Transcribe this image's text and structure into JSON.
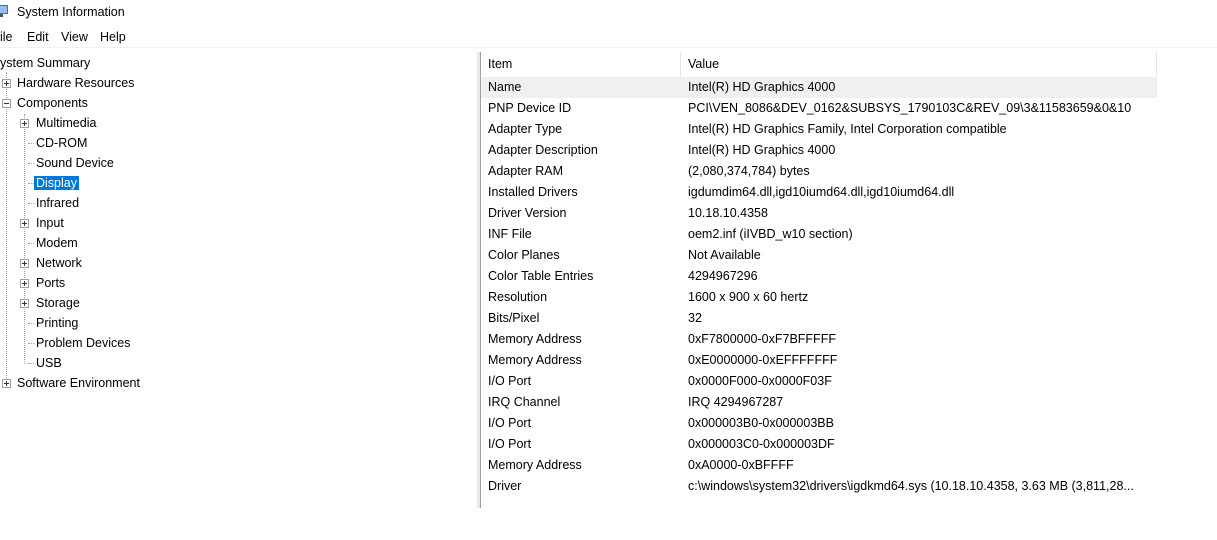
{
  "window": {
    "title": "System Information"
  },
  "menu": [
    "ile",
    "Edit",
    "View",
    "Help"
  ],
  "tree": {
    "root": "ystem Summary",
    "hardware_resources": "Hardware Resources",
    "components": "Components",
    "children": [
      "Multimedia",
      "CD-ROM",
      "Sound Device",
      "Display",
      "Infrared",
      "Input",
      "Modem",
      "Network",
      "Ports",
      "Storage",
      "Printing",
      "Problem Devices",
      "USB"
    ],
    "software_environment": "Software Environment",
    "selected": "Display"
  },
  "table": {
    "columns": [
      "Item",
      "Value"
    ],
    "rows": [
      [
        "Name",
        "Intel(R) HD Graphics 4000"
      ],
      [
        "PNP Device ID",
        "PCI\\VEN_8086&DEV_0162&SUBSYS_1790103C&REV_09\\3&11583659&0&10"
      ],
      [
        "Adapter Type",
        "Intel(R) HD Graphics Family, Intel Corporation compatible"
      ],
      [
        "Adapter Description",
        "Intel(R) HD Graphics 4000"
      ],
      [
        "Adapter RAM",
        "(2,080,374,784) bytes"
      ],
      [
        "Installed Drivers",
        "igdumdim64.dll,igd10iumd64.dll,igd10iumd64.dll"
      ],
      [
        "Driver Version",
        "10.18.10.4358"
      ],
      [
        "INF File",
        "oem2.inf (iIVBD_w10 section)"
      ],
      [
        "Color Planes",
        "Not Available"
      ],
      [
        "Color Table Entries",
        "4294967296"
      ],
      [
        "Resolution",
        "1600 x 900 x 60 hertz"
      ],
      [
        "Bits/Pixel",
        "32"
      ],
      [
        "Memory Address",
        "0xF7800000-0xF7BFFFFF"
      ],
      [
        "Memory Address",
        "0xE0000000-0xEFFFFFFF"
      ],
      [
        "I/O Port",
        "0x0000F000-0x0000F03F"
      ],
      [
        "IRQ Channel",
        "IRQ 4294967287"
      ],
      [
        "I/O Port",
        "0x000003B0-0x000003BB"
      ],
      [
        "I/O Port",
        "0x000003C0-0x000003DF"
      ],
      [
        "Memory Address",
        "0xA0000-0xBFFFF"
      ],
      [
        "Driver",
        "c:\\windows\\system32\\drivers\\igdkmd64.sys (10.18.10.4358, 3.63 MB (3,811,28..."
      ]
    ]
  },
  "colors": {
    "selection": "#0078d7",
    "row_highlight": "#f0f0f0"
  }
}
